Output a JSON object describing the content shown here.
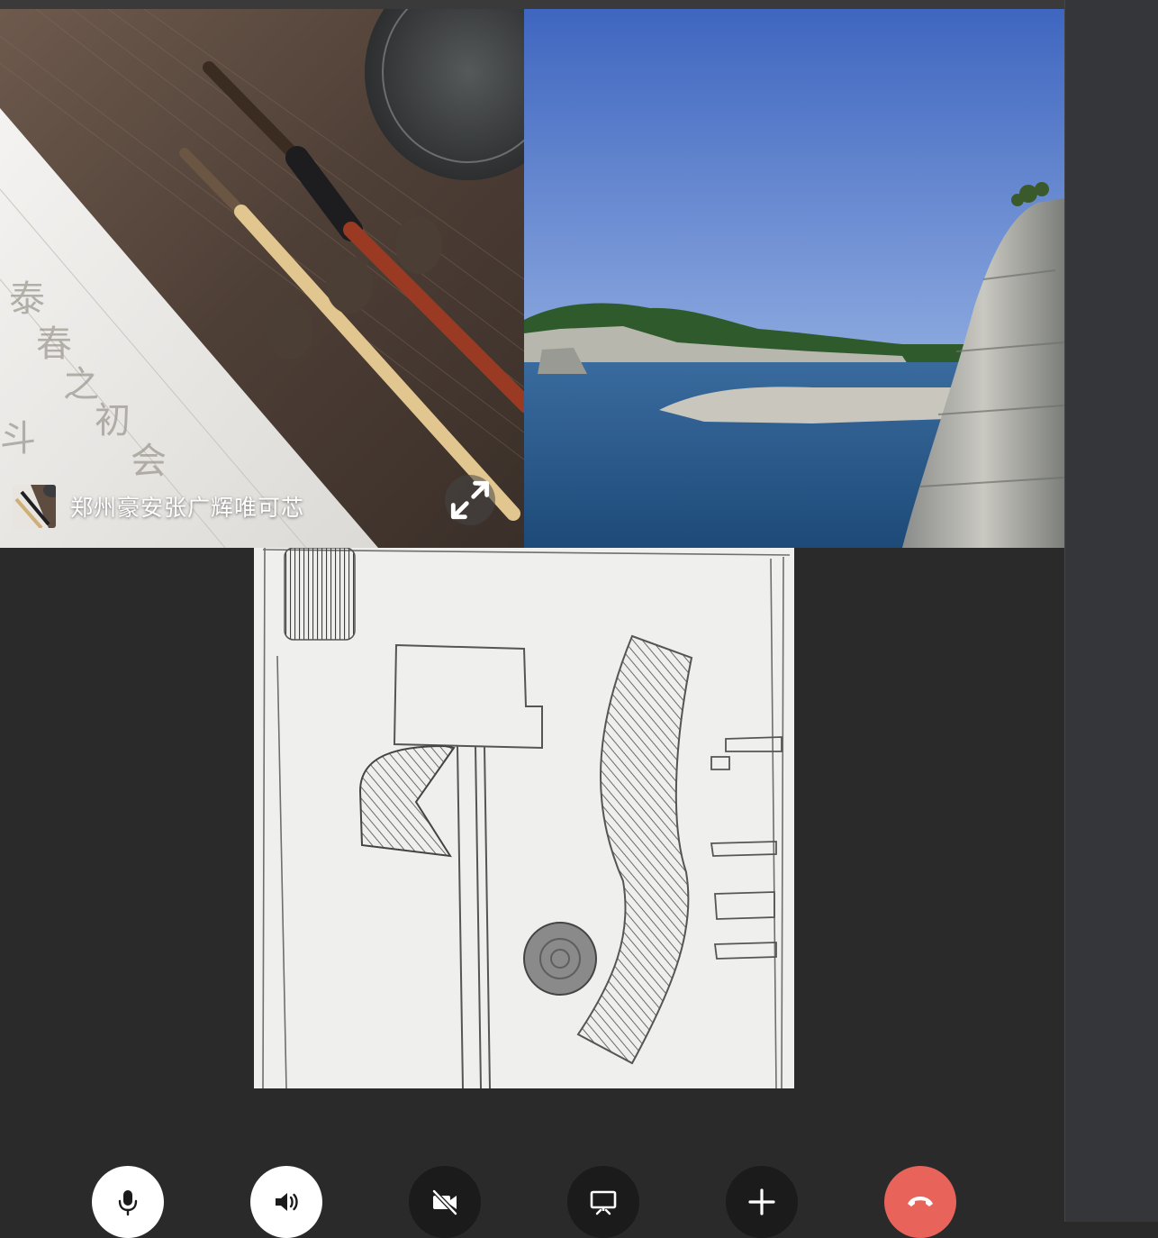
{
  "call": {
    "participants": [
      {
        "name": "郑州豪安张广辉唯可芯"
      }
    ]
  },
  "controls": [
    {
      "id": "mic",
      "icon": "microphone-icon"
    },
    {
      "id": "speaker",
      "icon": "speaker-icon"
    },
    {
      "id": "camera",
      "icon": "camera-off-icon"
    },
    {
      "id": "screen",
      "icon": "screen-share-icon"
    },
    {
      "id": "add",
      "icon": "plus-icon"
    },
    {
      "id": "hangup",
      "icon": "phone-hangup-icon"
    }
  ],
  "colors": {
    "background": "#2a2a2a",
    "panel": "#34363a",
    "hangup": "#e8645a",
    "button_light": "#ffffff",
    "button_dark": "#1b1b1b"
  }
}
